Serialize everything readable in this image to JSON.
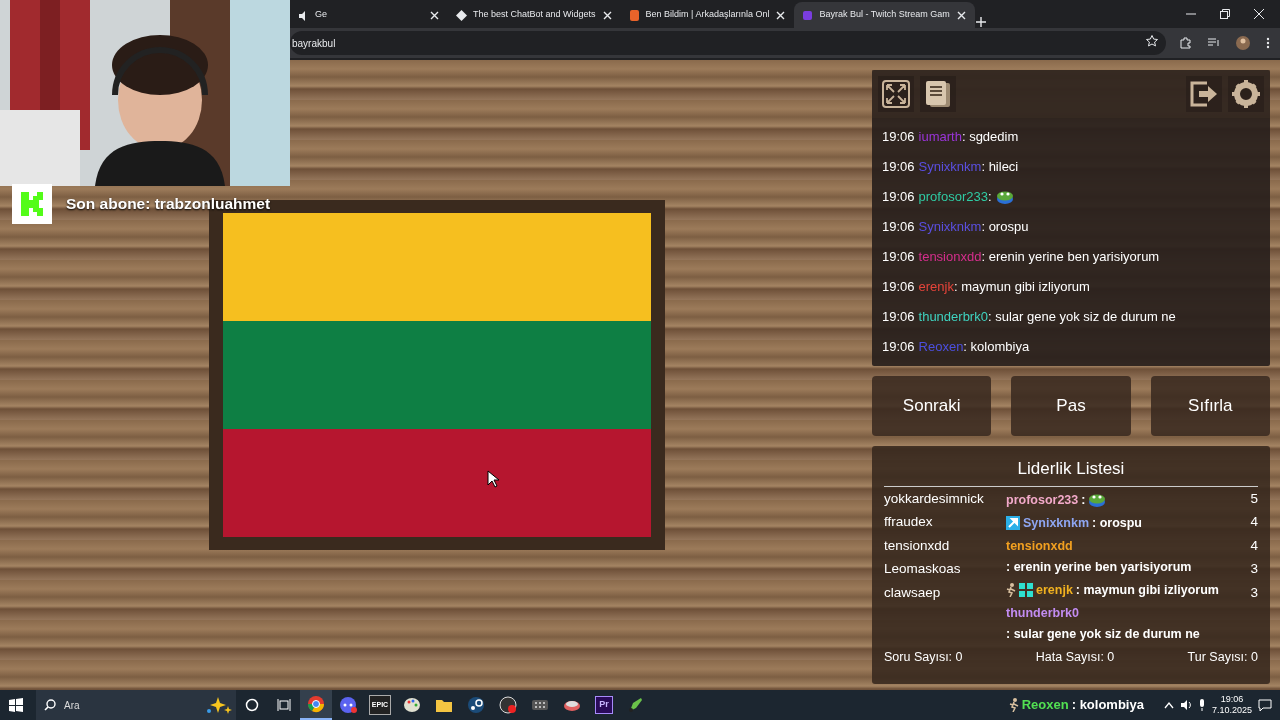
{
  "browser": {
    "tabs": [
      {
        "title": "Ge",
        "kind": "speaker",
        "selected": false
      },
      {
        "title": "The best ChatBot and Widgets",
        "kind": "diamond",
        "selected": false
      },
      {
        "title": "Ben Bildim | Arkadaşlarınla Onl",
        "kind": "bulb",
        "selected": false
      },
      {
        "title": "Bayrak Bul - Twitch Stream Gam",
        "kind": "flag",
        "selected": true
      }
    ],
    "address": "bayrakbul"
  },
  "subscriber": {
    "text": "Son abone: trabzonluahmet"
  },
  "flag": {
    "stripes": [
      {
        "color": "#f6bf1f"
      },
      {
        "color": "#0e7f44"
      },
      {
        "color": "#b6162f"
      }
    ]
  },
  "panel": {
    "toolbar": {
      "left": [
        {
          "kind": "expand"
        },
        {
          "kind": "document"
        }
      ],
      "right": [
        {
          "kind": "exit"
        },
        {
          "kind": "gear"
        }
      ]
    },
    "chat": [
      {
        "time": "19:06",
        "user": "iumarth",
        "color": "#9a34d8",
        "message": ": sgdedim"
      },
      {
        "time": "19:06",
        "user": "Synixknkm",
        "color": "#5a4fe0",
        "message": ": hileci"
      },
      {
        "time": "19:06",
        "user": "profosor233",
        "color": "#2fcba3",
        "message": ":",
        "emote": true
      },
      {
        "time": "19:06",
        "user": "Synixknkm",
        "color": "#5a4fe0",
        "message": ": orospu"
      },
      {
        "time": "19:06",
        "user": "tensionxdd",
        "color": "#d42e8c",
        "message": ": erenin yerine ben yarisiyorum"
      },
      {
        "time": "19:06",
        "user": "erenjk",
        "color": "#e6443a",
        "message": ": maymun gibi izliyorum"
      },
      {
        "time": "19:06",
        "user": "thunderbrk0",
        "color": "#3fd3c0",
        "message": ": sular gene yok siz de durum ne"
      },
      {
        "time": "19:06",
        "user": "Reoxen",
        "color": "#4c4fe0",
        "message": ": kolombiya"
      }
    ],
    "buttons": [
      "Sonraki",
      "Pas",
      "Sıfırla"
    ],
    "leaderboard": {
      "title": "Liderlik Listesi",
      "players": [
        {
          "name": "yokkardesimnick",
          "score": "5"
        },
        {
          "name": "ffraudex",
          "score": "4"
        },
        {
          "name": "tensionxdd",
          "score": "4"
        },
        {
          "name": "Leomaskoas",
          "score": "3"
        },
        {
          "name": "clawsaep",
          "score": "3"
        }
      ],
      "stats": [
        "Soru Sayısı: 0",
        "Hata Sayısı: 0",
        "Tur Sayısı: 0"
      ]
    }
  },
  "stream_chat": [
    {
      "user": "profosor233",
      "color": "#f2a9c9",
      "message": ":",
      "emote": true
    },
    {
      "user": "Synixknkm",
      "color": "#8ea6f2",
      "message": ": orospu",
      "badges": [
        {
          "kind": "tool"
        }
      ]
    },
    {
      "user": "tensionxdd",
      "color": "#f2a020",
      "message": ": erenin yerine ben yarisiyorum"
    },
    {
      "user": "erenjk",
      "color": "#f2b21f",
      "message": ": maymun gibi izliyorum",
      "badges": [
        {
          "kind": "runner"
        },
        {
          "kind": "mosaic"
        }
      ]
    },
    {
      "user": "thunderbrk0",
      "color": "#c28cf2",
      "message": ": sular gene yok siz de durum ne"
    },
    {
      "user": "Reoxen",
      "color": "#52e052",
      "message": ": kolombiya",
      "badges": [
        {
          "kind": "runner"
        }
      ]
    }
  ],
  "taskbar": {
    "search_placeholder": "Ara",
    "apps": [
      {
        "kind": "browser",
        "selected": true
      },
      {
        "kind": "chat",
        "selected": false
      },
      {
        "kind": "epic",
        "label": "EPIC",
        "selected": false
      },
      {
        "kind": "paint",
        "selected": false
      },
      {
        "kind": "folder",
        "selected": false
      },
      {
        "kind": "steam",
        "selected": false
      },
      {
        "kind": "recorder",
        "selected": false
      },
      {
        "kind": "grid",
        "selected": false
      },
      {
        "kind": "mouse",
        "selected": false
      },
      {
        "kind": "premiere",
        "label": "Pr",
        "selected": false
      },
      {
        "kind": "pen",
        "selected": false
      }
    ],
    "time": "19:06",
    "date": "7.10.2025"
  }
}
